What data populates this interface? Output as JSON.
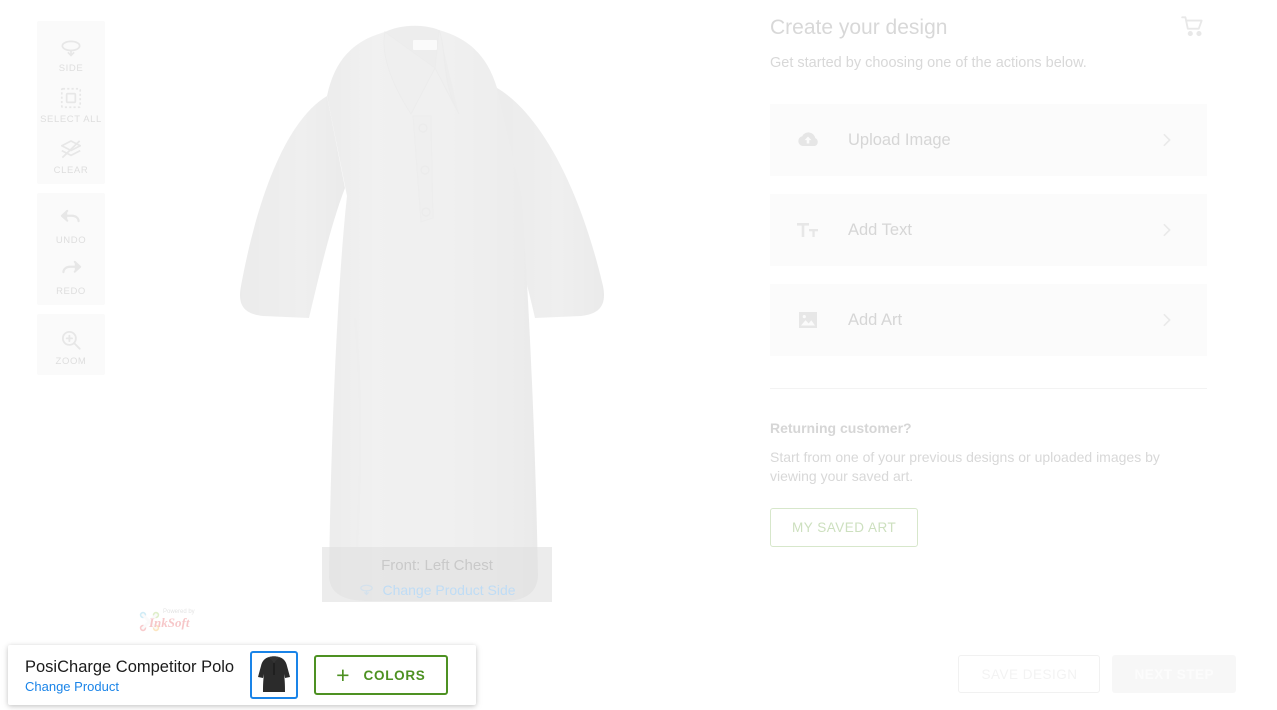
{
  "toolbar": {
    "groups": [
      {
        "items": [
          {
            "label": "SIDE",
            "icon": "rotate-side-icon"
          },
          {
            "label": "SELECT ALL",
            "icon": "select-all-icon"
          },
          {
            "label": "CLEAR",
            "icon": "clear-layers-icon"
          }
        ]
      },
      {
        "items": [
          {
            "label": "UNDO",
            "icon": "undo-arrow-icon"
          },
          {
            "label": "REDO",
            "icon": "redo-arrow-icon"
          }
        ]
      },
      {
        "items": [
          {
            "label": "ZOOM",
            "icon": "zoom-in-magnifier-icon"
          }
        ]
      }
    ]
  },
  "canvas": {
    "design_area_label": "Front: Left Chest",
    "change_side_label": "Change Product Side",
    "change_side_icon": "rotate-side-icon",
    "watermark_text": "Powered by InkSoft",
    "product_color": "#cfcfcf"
  },
  "panel": {
    "title": "Create your design",
    "subtitle": "Get started by choosing one of the actions below.",
    "cart_icon": "shopping-cart-icon",
    "actions": [
      {
        "label": "Upload Image",
        "icon": "cloud-upload-icon",
        "chevron": "chevron-right-icon"
      },
      {
        "label": "Add Text",
        "icon": "text-format-icon",
        "chevron": "chevron-right-icon"
      },
      {
        "label": "Add Art",
        "icon": "image-art-icon",
        "chevron": "chevron-right-icon"
      }
    ],
    "returning": {
      "title": "Returning customer?",
      "body": "Start from one of your previous designs or uploaded images by viewing your saved art.",
      "button_label": "MY SAVED ART",
      "button_color": "#cde0bf"
    }
  },
  "bottom": {
    "product_name": "PosiCharge Competitor Polo",
    "change_product_label": "Change Product",
    "change_product_color": "#1a84e8",
    "swatch_color": "#2b2b2b",
    "swatch_border_color": "#1a84e8",
    "colors_button_label": "COLORS",
    "colors_button_color": "#4d9122",
    "save_design_label": "SAVE DESIGN",
    "next_step_label": "NEXT STEP"
  }
}
